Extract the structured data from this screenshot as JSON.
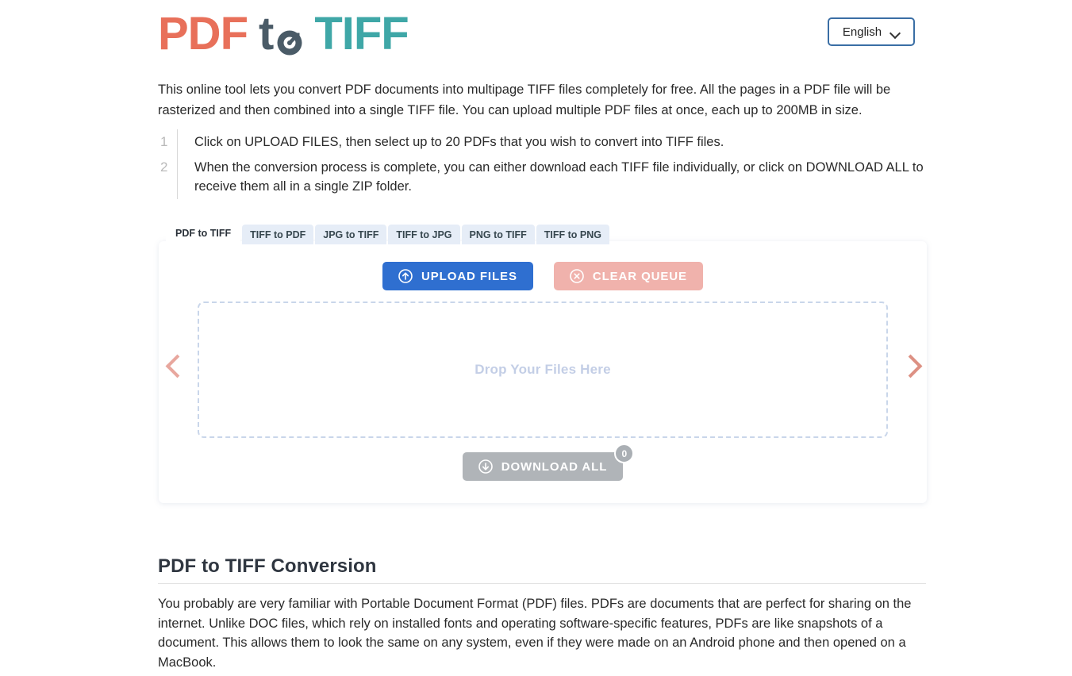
{
  "header": {
    "logo": {
      "part1": "PDF",
      "part2": "to",
      "part3": "TIFF",
      "icon": "circular-convert-arrow-icon",
      "color_part1": "#e8705a",
      "color_part2": "#4a5b67",
      "color_part3": "#3fa7a7"
    },
    "language": {
      "value": "English",
      "icon": "chevron-down-icon",
      "border_color": "#3a6ea5"
    }
  },
  "intro": {
    "paragraph": "This online tool lets you convert PDF documents into multipage TIFF files completely for free. All the pages in a PDF file will be rasterized and then combined into a single TIFF file. You can upload multiple PDF files at once, each up to 200MB in size.",
    "steps": [
      {
        "number": "1",
        "text": "Click on UPLOAD FILES, then select up to 20 PDFs that you wish to convert into TIFF files."
      },
      {
        "number": "2",
        "text": "When the conversion process is complete, you can either download each TIFF file individually, or click on DOWNLOAD ALL to receive them all in a single ZIP folder."
      }
    ]
  },
  "tabs": [
    {
      "label": "PDF to TIFF",
      "active": true
    },
    {
      "label": "TIFF to PDF",
      "active": false
    },
    {
      "label": "JPG to TIFF",
      "active": false
    },
    {
      "label": "TIFF to JPG",
      "active": false
    },
    {
      "label": "PNG to TIFF",
      "active": false
    },
    {
      "label": "TIFF to PNG",
      "active": false
    }
  ],
  "converter": {
    "upload_button": {
      "label": "UPLOAD FILES",
      "icon": "upload-arrow-circle-icon",
      "color": "#2f6fd0"
    },
    "clear_button": {
      "label": "CLEAR QUEUE",
      "icon": "close-circle-icon",
      "color": "#f0b2ac"
    },
    "dropzone": {
      "text": "Drop Your Files Here",
      "text_color": "#c3cee6",
      "border_color": "#c9d6ea"
    },
    "prev_arrow_icon": "chevron-left-icon",
    "next_arrow_icon": "chevron-right-icon",
    "download_all_button": {
      "label": "DOWNLOAD ALL",
      "icon": "download-arrow-circle-icon",
      "badge_count": "0",
      "color": "#b0b4b8"
    }
  },
  "article": {
    "title": "PDF to TIFF Conversion",
    "body": "You probably are very familiar with Portable Document Format (PDF) files. PDFs are documents that are perfect for sharing on the internet. Unlike DOC files, which rely on installed fonts and operating software-specific features, PDFs are like snapshots of a document. This allows them to look the same on any system, even if they were made on an Android phone and then opened on a MacBook."
  }
}
